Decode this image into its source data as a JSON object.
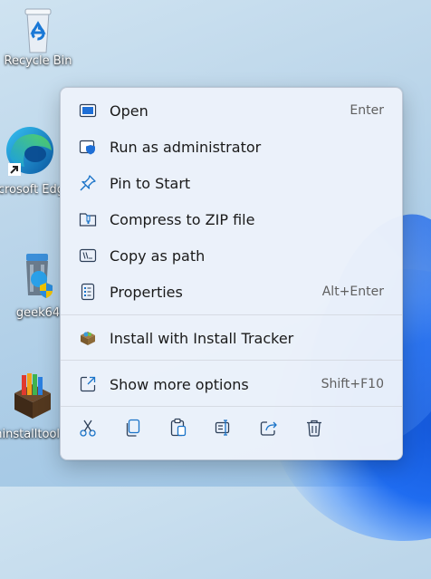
{
  "desktop": {
    "icons": [
      {
        "label": "Recycle Bin",
        "icon": "recycle-bin-icon"
      },
      {
        "label": "Microsoft Edge",
        "icon": "edge-icon"
      },
      {
        "label": "geek64",
        "icon": "geek-uninstaller-icon"
      },
      {
        "label": "uninstalltool",
        "icon": "uninstall-tool-icon"
      }
    ]
  },
  "menu": {
    "items": [
      {
        "label": "Open",
        "shortcut": "Enter",
        "icon": "open-window-icon"
      },
      {
        "label": "Run as administrator",
        "shortcut": "",
        "icon": "shield-icon"
      },
      {
        "label": "Pin to Start",
        "shortcut": "",
        "icon": "pin-icon"
      },
      {
        "label": "Compress to ZIP file",
        "shortcut": "",
        "icon": "zip-folder-icon"
      },
      {
        "label": "Copy as path",
        "shortcut": "",
        "icon": "copy-path-icon"
      },
      {
        "label": "Properties",
        "shortcut": "Alt+Enter",
        "icon": "properties-icon"
      },
      {
        "label": "Install with Install Tracker",
        "shortcut": "",
        "icon": "install-tracker-icon"
      },
      {
        "label": "Show more options",
        "shortcut": "Shift+F10",
        "icon": "more-options-icon"
      }
    ],
    "toolbar": [
      {
        "name": "cut",
        "icon": "scissors-icon"
      },
      {
        "name": "copy",
        "icon": "copy-icon"
      },
      {
        "name": "paste",
        "icon": "paste-icon"
      },
      {
        "name": "rename",
        "icon": "rename-icon"
      },
      {
        "name": "share",
        "icon": "share-icon"
      },
      {
        "name": "delete",
        "icon": "trash-icon"
      }
    ]
  },
  "colors": {
    "accent": "#1a73c8",
    "menu_bg": "#ecf2fa"
  }
}
